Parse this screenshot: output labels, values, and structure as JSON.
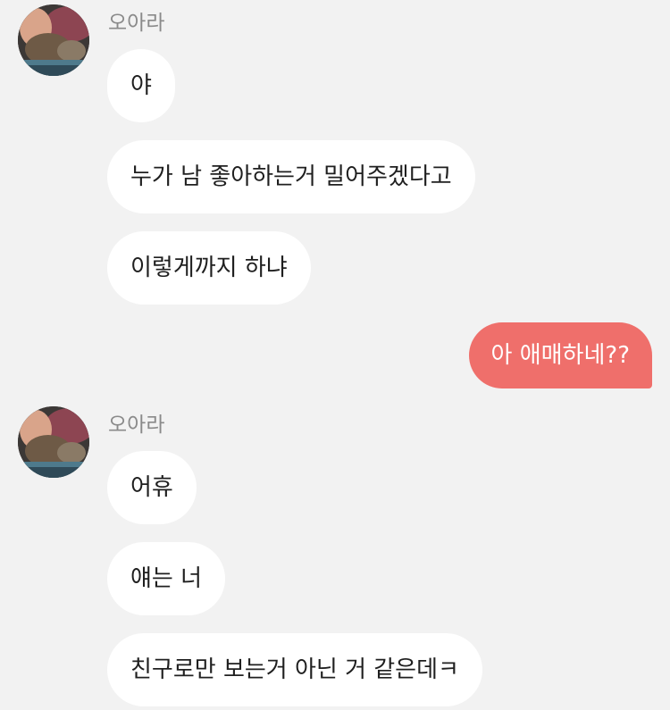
{
  "messages": [
    {
      "sender": "오아라",
      "lines": [
        "야",
        "누가 남 좋아하는거 밀어주겠다고",
        "이렇게까지 하냐"
      ]
    },
    {
      "self_reply": "아 애매하네??"
    },
    {
      "sender": "오아라",
      "lines": [
        "어휴",
        "얘는 너",
        "친구로만 보는거 아닌 거 같은데ㅋ"
      ]
    }
  ],
  "colors": {
    "background": "#f2f2f2",
    "incoming_bubble": "#ffffff",
    "outgoing_bubble": "#ef6f6b",
    "sender_name": "#8a8a8a"
  },
  "icons": {
    "avatar": "cat-photo-avatar"
  }
}
